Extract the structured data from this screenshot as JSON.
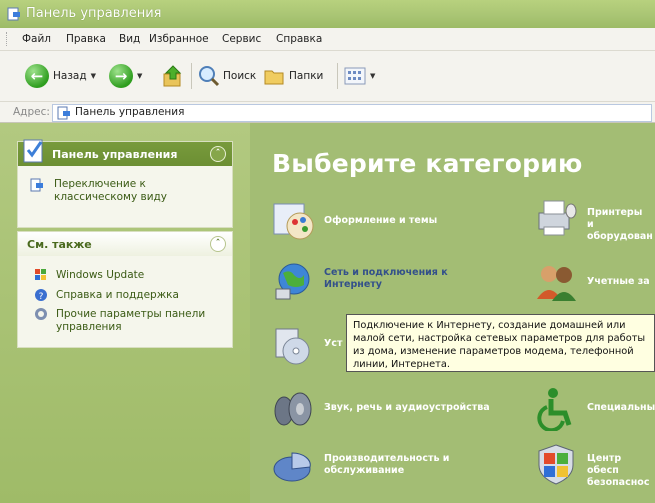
{
  "window": {
    "title": "Панель управления"
  },
  "menubar": {
    "items": [
      "Файл",
      "Правка",
      "Вид",
      "Избранное",
      "Сервис",
      "Справка"
    ]
  },
  "toolbar": {
    "back_label": "Назад",
    "search_label": "Поиск",
    "folders_label": "Папки"
  },
  "address": {
    "label": "Адрес:",
    "value": "Панель управления"
  },
  "sidebar": {
    "control_panel": {
      "title": "Панель управления",
      "link": "Переключение к классическому виду"
    },
    "see_also": {
      "title": "См. также",
      "links": [
        "Windows Update",
        "Справка и поддержка",
        "Прочие параметры панели управления"
      ]
    }
  },
  "main": {
    "heading": "Выберите категорию",
    "categories": [
      {
        "label": "Оформление и темы",
        "icon": "appearance-icon"
      },
      {
        "label": "Принтеры и оборудован",
        "icon": "printer-icon"
      },
      {
        "label": "Сеть и подключения к Интернету",
        "icon": "network-icon"
      },
      {
        "label": "Учетные за",
        "icon": "user-accounts-icon"
      },
      {
        "label": "Уст",
        "icon": "programs-icon"
      },
      {
        "label": "Звук, речь и аудиоустройства",
        "icon": "sound-icon"
      },
      {
        "label": "Специальны",
        "icon": "accessibility-icon"
      },
      {
        "label": "Производительность и обслуживание",
        "icon": "performance-icon"
      },
      {
        "label": "Центр обесп безопаснос",
        "icon": "security-shield-icon"
      }
    ]
  },
  "tooltip": {
    "text": "Подключение к Интернету, создание домашней или малой сети, настройка сетевых параметров для работы из дома, изменение параметров модема, телефонной линии, Интернета."
  },
  "colors": {
    "sidebar_green": "#a3bd74",
    "panel_header": "#6f9235",
    "link_blue": "#33508a",
    "tooltip_bg": "#ffffe1"
  }
}
